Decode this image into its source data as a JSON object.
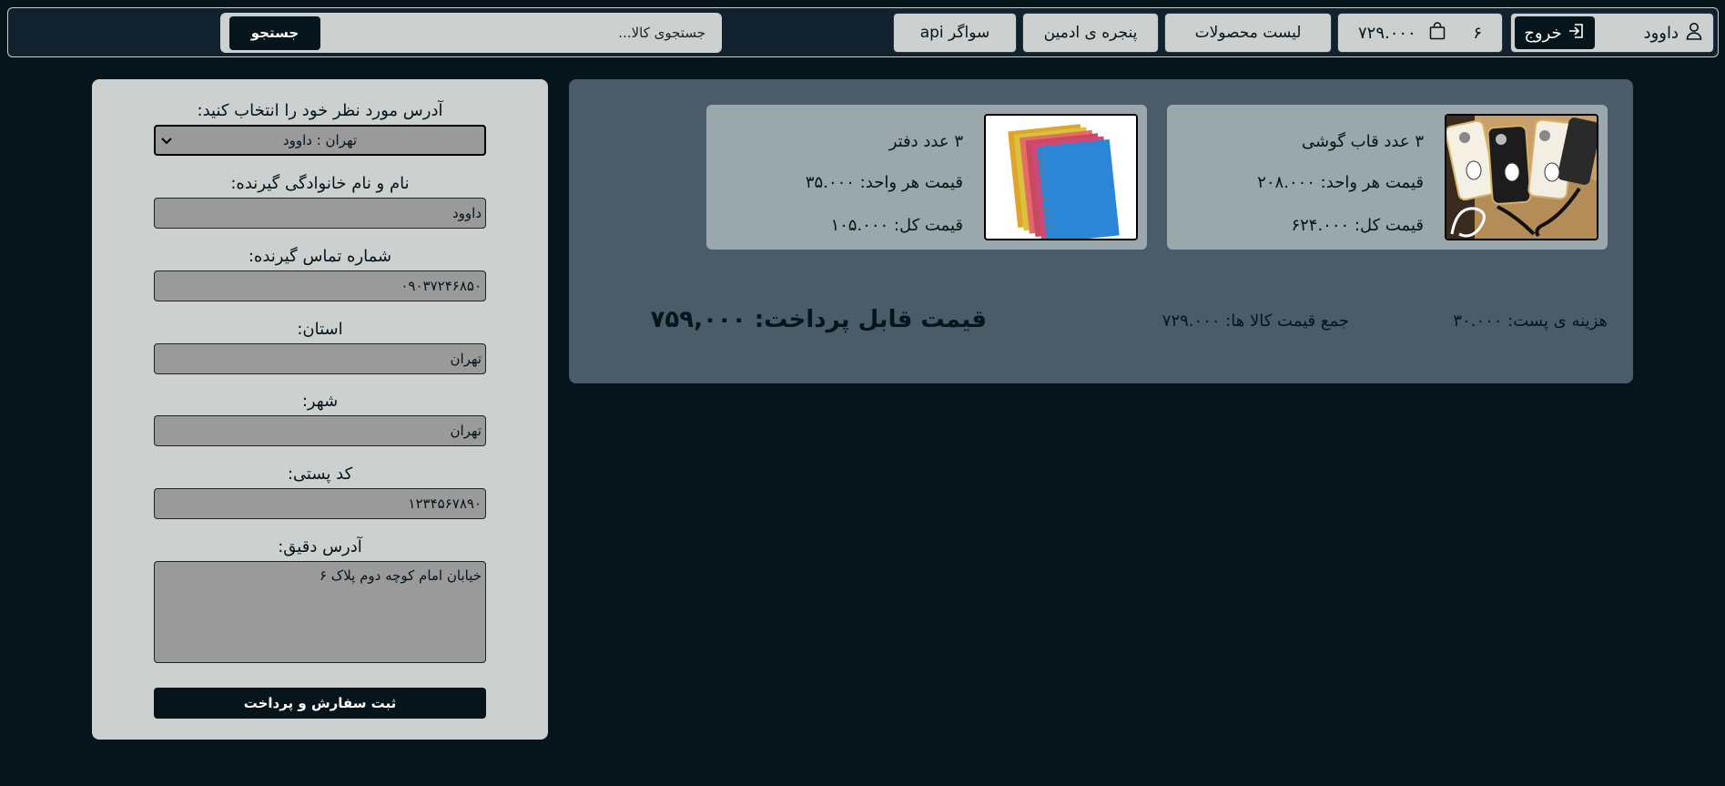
{
  "navbar": {
    "user_name": "داوود",
    "logout_label": "خروج",
    "cart_count": "۶",
    "cart_total": "۷۲۹.۰۰۰",
    "products_label": "لیست محصولات",
    "admin_label": "پنجره ی ادمین",
    "swagger_label": "سواگر api",
    "search_placeholder": "جستجوی کالا...",
    "search_button": "جستجو"
  },
  "cart": {
    "items": [
      {
        "title": "۳ عدد قاب گوشی",
        "unit_price": "قیمت هر واحد: ۲۰۸.۰۰۰",
        "total_price": "قیمت کل: ۶۲۴.۰۰۰",
        "image_icon": "phone-case-image"
      },
      {
        "title": "۳ عدد دفتر",
        "unit_price": "قیمت هر واحد: ۳۵.۰۰۰",
        "total_price": "قیمت کل: ۱۰۵.۰۰۰",
        "image_icon": "notebook-image"
      }
    ],
    "shipping": "هزینه ی پست: ۳۰.۰۰۰",
    "items_sum": "جمع قیمت کالا ها: ۷۲۹.۰۰۰",
    "payable": "قیمت قابل پرداخت: ۷۵۹,۰۰۰"
  },
  "form": {
    "address_select_label": "آدرس مورد نظر خود را انتخاب کنید:",
    "address_select_value": "تهران : داوود",
    "receiver_name_label": "نام و نام خانوادگی گیرنده:",
    "receiver_name_value": "داوود",
    "receiver_phone_label": "شماره تماس گیرنده:",
    "receiver_phone_value": "۰۹۰۳۷۲۴۶۸۵۰",
    "province_label": "استان:",
    "province_value": "تهران",
    "city_label": "شهر:",
    "city_value": "تهران",
    "postal_code_label": "کد پستی:",
    "postal_code_value": "۱۲۳۴۵۶۷۸۹۰",
    "address_label": "آدرس دقیق:",
    "address_value": "خیابان امام کوچه دوم پلاک ۶",
    "submit_label": "ثبت سفارش و پرداخت"
  }
}
